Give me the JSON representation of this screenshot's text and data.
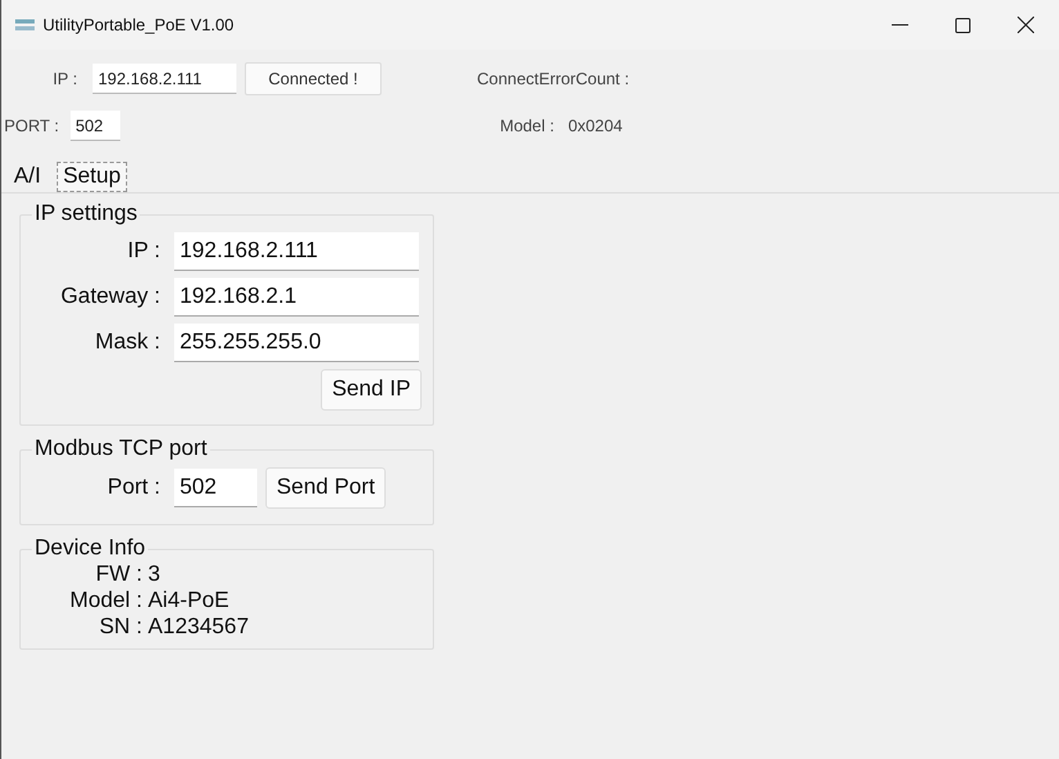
{
  "window": {
    "title": "UtilityPortable_PoE V1.00"
  },
  "connection": {
    "ip_label": "IP :",
    "ip_value": "192.168.2.111",
    "status_button": "Connected !",
    "port_label": "PORT :",
    "port_value": "502",
    "error_count_label": "ConnectErrorCount :",
    "model_label": "Model :",
    "model_value": "0x0204"
  },
  "tabs": [
    {
      "label": "A/I",
      "selected": false
    },
    {
      "label": "Setup",
      "selected": true
    }
  ],
  "ip_settings": {
    "title": "IP settings",
    "fields": [
      {
        "label": "IP :",
        "value": "192.168.2.111"
      },
      {
        "label": "Gateway :",
        "value": "192.168.2.1"
      },
      {
        "label": "Mask :",
        "value": "255.255.255.0"
      }
    ],
    "button": "Send IP"
  },
  "modbus": {
    "title": "Modbus TCP port",
    "label": "Port :",
    "value": "502",
    "button": "Send Port"
  },
  "device_info": {
    "title": "Device Info",
    "rows": [
      {
        "label": "FW :",
        "value": "3"
      },
      {
        "label": "Model :",
        "value": "Ai4-PoE"
      },
      {
        "label": "SN :",
        "value": "A1234567"
      }
    ]
  }
}
